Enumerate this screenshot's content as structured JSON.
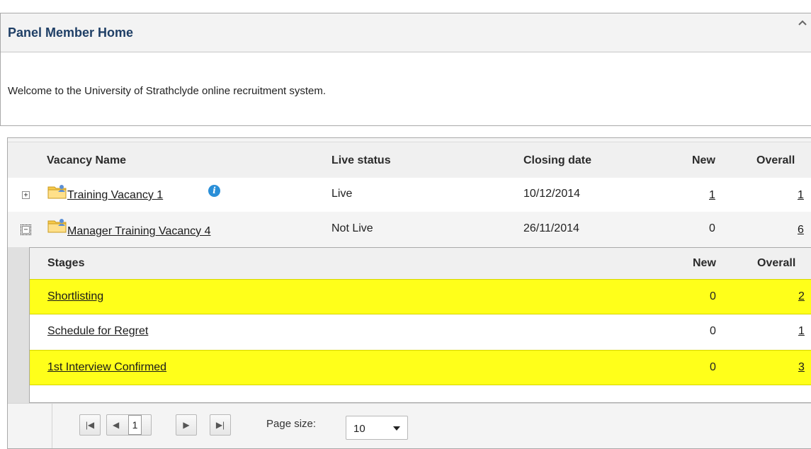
{
  "home": {
    "title": "Panel Member Home",
    "welcome": "Welcome to the University of Strathclyde online recruitment system."
  },
  "grid": {
    "columns": {
      "name": "Vacancy Name",
      "live": "Live status",
      "closing": "Closing date",
      "new": "New",
      "overall": "Overall"
    },
    "rows": [
      {
        "name": "Training Vacancy 1",
        "live": "Live",
        "closing": "10/12/2014",
        "new": "1",
        "overall": "1",
        "expander": "+"
      },
      {
        "name": "Manager Training Vacancy 4",
        "live": "Not Live",
        "closing": "26/11/2014",
        "new": "0",
        "overall": "6",
        "expander": "−"
      }
    ]
  },
  "stages": {
    "columns": {
      "stage": "Stages",
      "new": "New",
      "overall": "Overall"
    },
    "rows": [
      {
        "name": "Shortlisting",
        "new": "0",
        "overall": "2",
        "highlight": true
      },
      {
        "name": "Schedule for Regret",
        "new": "0",
        "overall": "1",
        "highlight": false
      },
      {
        "name": "1st Interview Confirmed",
        "new": "0",
        "overall": "3",
        "highlight": true
      }
    ]
  },
  "pager": {
    "first": "|◀",
    "prev": "◀",
    "current_page": "1",
    "next": "▶",
    "last": "▶|",
    "page_size_label": "Page size:",
    "page_size_value": "10"
  },
  "colors": {
    "highlight": "#ffff1a",
    "title": "#1f3f66",
    "info": "#2a8fd8"
  },
  "icons": {
    "collapse": "chevron-up-icon",
    "folder": "folder-user-icon",
    "info": "info-icon"
  }
}
